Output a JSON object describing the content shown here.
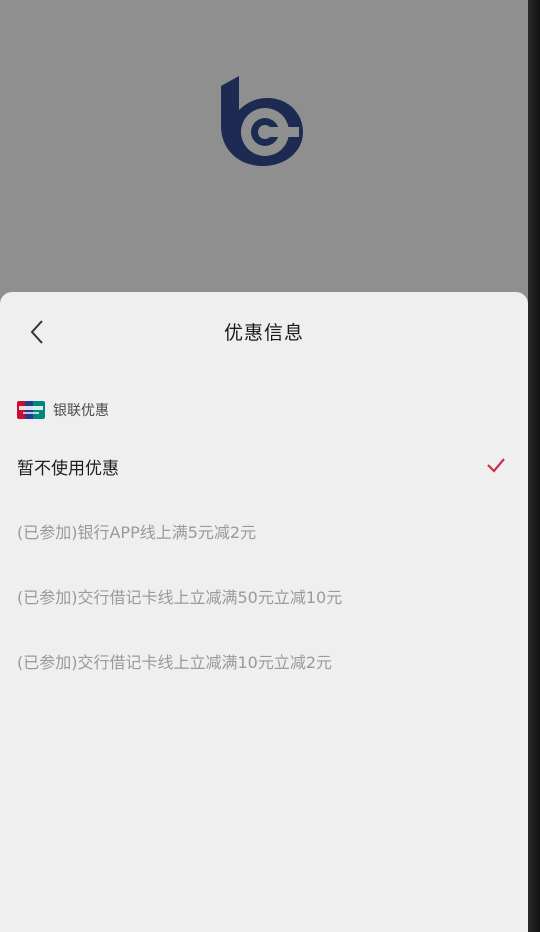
{
  "header": {
    "title": "优惠信息"
  },
  "section": {
    "label": "银联优惠"
  },
  "options": [
    {
      "label": "暂不使用优惠",
      "selected": true
    },
    {
      "label": "(已参加)银行APP线上满5元减2元",
      "selected": false
    },
    {
      "label": "(已参加)交行借记卡线上立减满50元立减10元",
      "selected": false
    },
    {
      "label": "(已参加)交行借记卡线上立减满10元立减2元",
      "selected": false
    }
  ],
  "colors": {
    "accent": "#c8324a",
    "logo": "#1d2a52",
    "sheet_bg": "#efefef",
    "backdrop": "#8f8f8f"
  },
  "icons": {
    "back": "chevron-left-icon",
    "selected": "check-icon",
    "section": "unionpay-logo-icon",
    "brand": "bank-logo-icon"
  }
}
